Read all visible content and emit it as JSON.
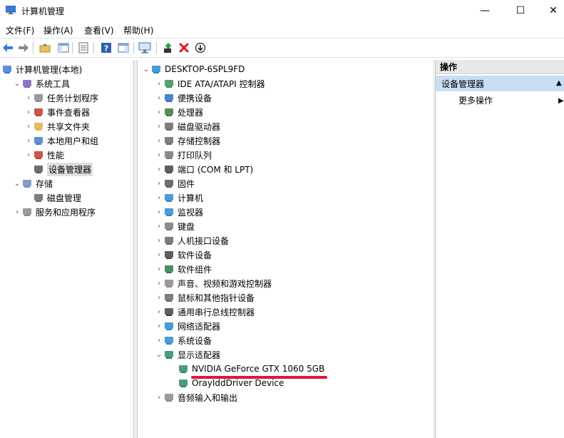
{
  "window": {
    "title": "计算机管理",
    "minimize": "—",
    "maximize": "☐",
    "close": "✕"
  },
  "menu": [
    "文件(F)",
    "操作(A)",
    "查看(V)",
    "帮助(H)"
  ],
  "left_tree": [
    {
      "label": "计算机管理(本地)",
      "icon": "computer-management-icon",
      "level": 0,
      "expander": ""
    },
    {
      "label": "系统工具",
      "icon": "system-tools-icon",
      "level": 1,
      "expander": "v"
    },
    {
      "label": "任务计划程序",
      "icon": "task-scheduler-icon",
      "level": 2,
      "expander": ">"
    },
    {
      "label": "事件查看器",
      "icon": "event-viewer-icon",
      "level": 2,
      "expander": ">"
    },
    {
      "label": "共享文件夹",
      "icon": "shared-folders-icon",
      "level": 2,
      "expander": ">"
    },
    {
      "label": "本地用户和组",
      "icon": "local-users-icon",
      "level": 2,
      "expander": ">"
    },
    {
      "label": "性能",
      "icon": "performance-icon",
      "level": 2,
      "expander": ">"
    },
    {
      "label": "设备管理器",
      "icon": "device-manager-icon",
      "level": 2,
      "expander": "",
      "selected": true
    },
    {
      "label": "存储",
      "icon": "storage-icon",
      "level": 1,
      "expander": "v"
    },
    {
      "label": "磁盘管理",
      "icon": "disk-management-icon",
      "level": 2,
      "expander": ""
    },
    {
      "label": "服务和应用程序",
      "icon": "services-apps-icon",
      "level": 1,
      "expander": ">"
    }
  ],
  "device_tree": {
    "root": "DESKTOP-6SPL9FD",
    "categories": [
      {
        "label": "IDE ATA/ATAPI 控制器",
        "icon": "ide-controller-icon"
      },
      {
        "label": "便携设备",
        "icon": "portable-device-icon"
      },
      {
        "label": "处理器",
        "icon": "processor-icon"
      },
      {
        "label": "磁盘驱动器",
        "icon": "disk-drive-icon"
      },
      {
        "label": "存储控制器",
        "icon": "storage-controller-icon"
      },
      {
        "label": "打印队列",
        "icon": "printer-icon"
      },
      {
        "label": "端口 (COM 和 LPT)",
        "icon": "port-icon"
      },
      {
        "label": "固件",
        "icon": "firmware-icon"
      },
      {
        "label": "计算机",
        "icon": "computer-icon"
      },
      {
        "label": "监视器",
        "icon": "monitor-icon"
      },
      {
        "label": "键盘",
        "icon": "keyboard-icon"
      },
      {
        "label": "人机接口设备",
        "icon": "hid-icon"
      },
      {
        "label": "软件设备",
        "icon": "software-device-icon"
      },
      {
        "label": "软件组件",
        "icon": "software-component-icon"
      },
      {
        "label": "声音、视频和游戏控制器",
        "icon": "sound-icon"
      },
      {
        "label": "鼠标和其他指针设备",
        "icon": "mouse-icon"
      },
      {
        "label": "通用串行总线控制器",
        "icon": "usb-icon"
      },
      {
        "label": "网络适配器",
        "icon": "network-adapter-icon"
      },
      {
        "label": "系统设备",
        "icon": "system-device-icon"
      },
      {
        "label": "显示适配器",
        "icon": "display-adapter-icon",
        "expanded": true,
        "children": [
          "NVIDIA GeForce GTX 1060 5GB",
          "OrayIddDriver Device"
        ]
      },
      {
        "label": "音频输入和输出",
        "icon": "audio-io-icon"
      }
    ]
  },
  "actions_pane": {
    "header": "操作",
    "selected": "设备管理器",
    "more": "更多操作"
  },
  "colors": {
    "annotation": "#e0153a",
    "selection": "#c9def5",
    "accent_green": "#1e9c3c",
    "delete_red": "#e81123"
  }
}
